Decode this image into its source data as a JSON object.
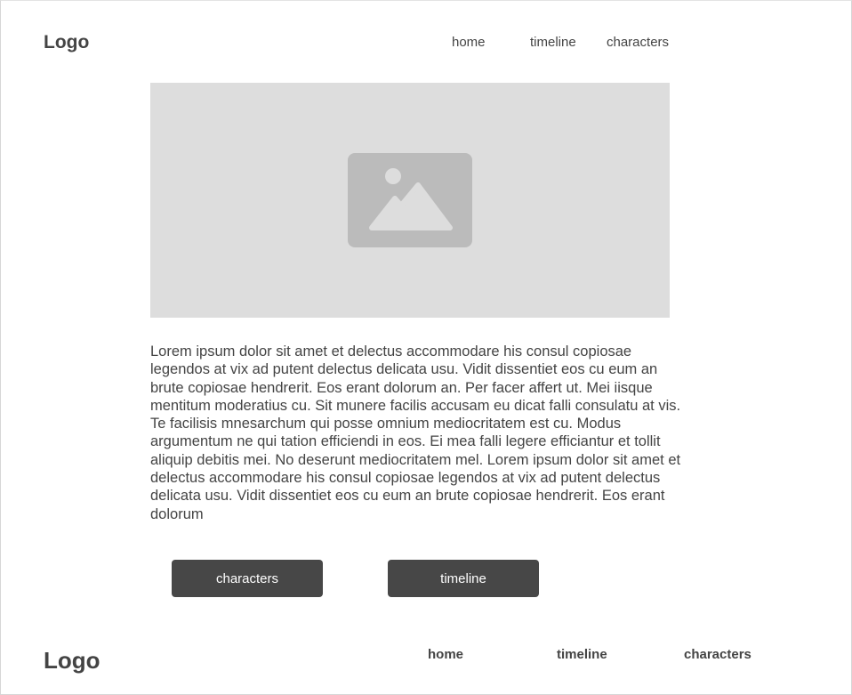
{
  "header": {
    "logo": "Logo",
    "nav": {
      "home": "home",
      "timeline": "timeline",
      "characters": "characters"
    }
  },
  "hero": {
    "icon": "image-placeholder-icon"
  },
  "content": {
    "paragraph": "Lorem ipsum dolor sit amet et delectus accommodare his consul copiosae legendos at vix ad putent delectus delicata usu. Vidit dissentiet eos cu eum an brute copiosae hendrerit. Eos erant dolorum an. Per facer affert ut. Mei iisque mentitum moderatius cu. Sit munere facilis accusam eu dicat falli consulatu at vis. Te facilisis mnesarchum qui posse omnium mediocritatem est cu. Modus argumentum ne qui tation efficiendi in eos. Ei mea falli legere efficiantur et tollit aliquip debitis mei. No deserunt mediocritatem mel. Lorem ipsum dolor sit amet et delectus accommodare his consul copiosae legendos at vix ad putent delectus delicata usu. Vidit dissentiet eos cu eum an brute copiosae hendrerit. Eos erant dolorum"
  },
  "actions": {
    "characters_label": "characters",
    "timeline_label": "timeline"
  },
  "footer": {
    "logo": "Logo",
    "nav": {
      "home": "home",
      "timeline": "timeline",
      "characters": "characters"
    }
  },
  "colors": {
    "text": "#444444",
    "placeholder_bg": "#dddddd",
    "placeholder_icon": "#bbbbbb",
    "button_bg": "#474747",
    "button_text": "#ffffff"
  }
}
